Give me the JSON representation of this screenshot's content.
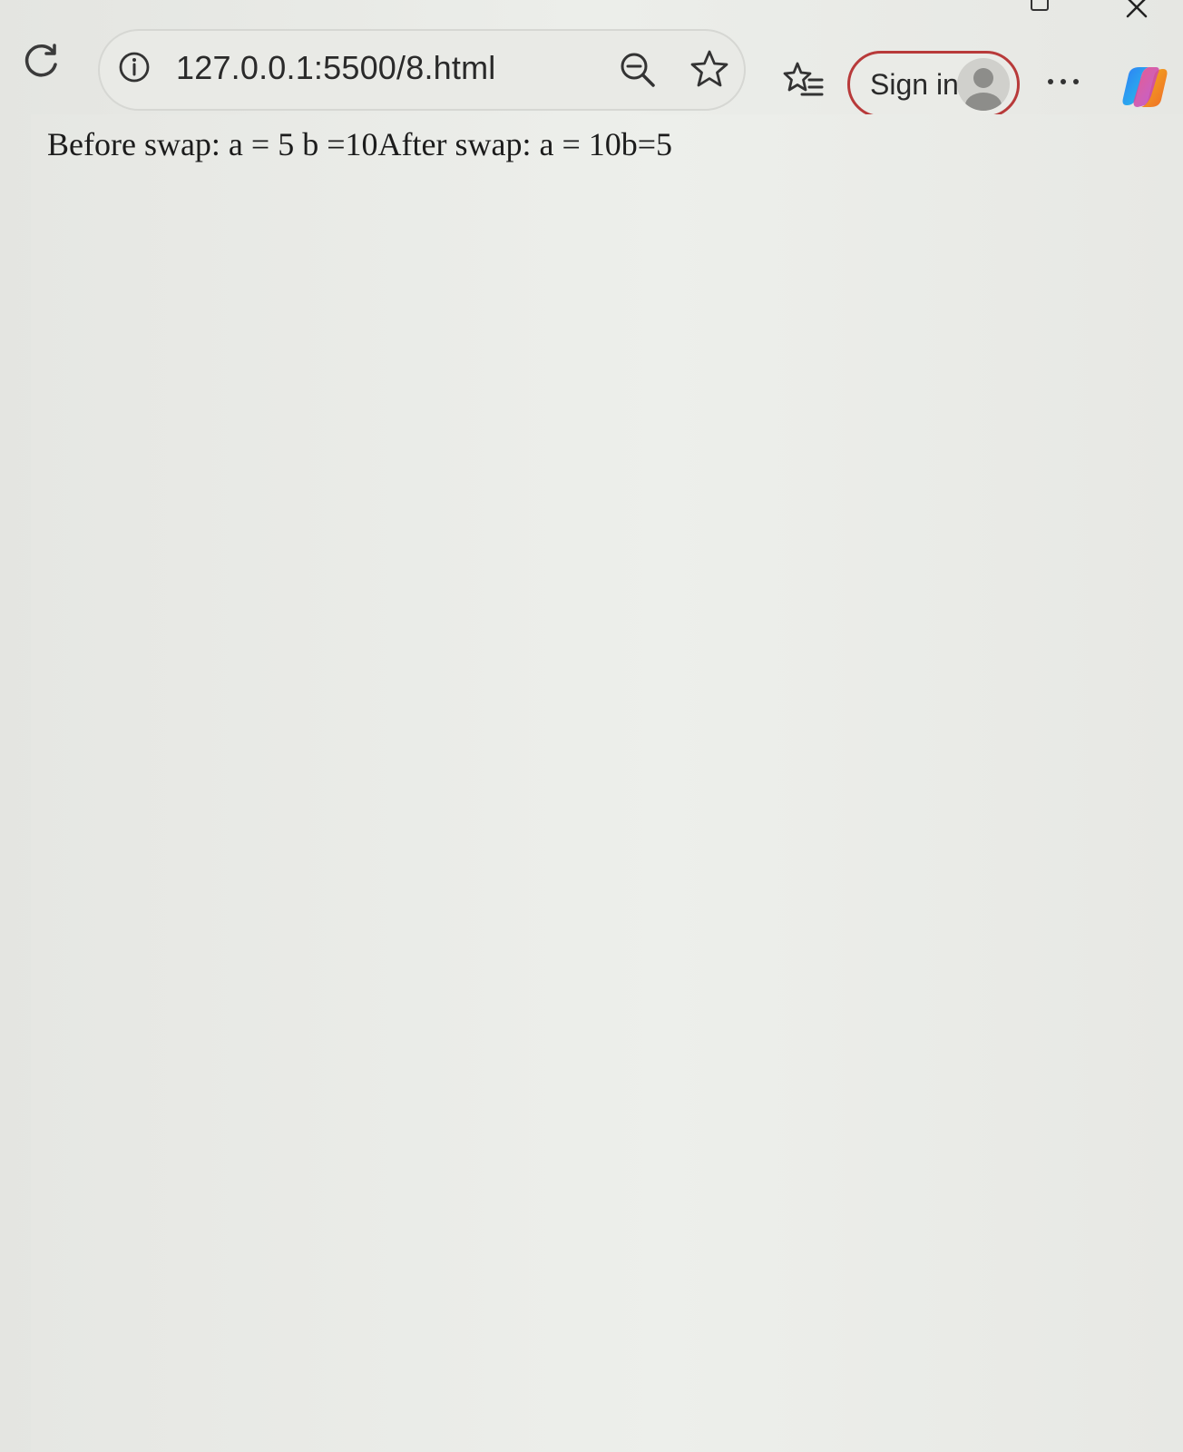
{
  "window": {
    "controls": [
      "restore-icon",
      "close-icon"
    ]
  },
  "toolbar": {
    "url": "127.0.0.1:5500/8.html",
    "signin_label": "Sign in",
    "icons": [
      "refresh-icon",
      "info-icon",
      "zoom-out-icon",
      "star-icon",
      "favorites-icon",
      "avatar",
      "more-icon",
      "copilot-icon"
    ]
  },
  "page": {
    "output": "Before swap: a = 5 b =10After swap: a = 10b=5"
  },
  "colors": {
    "signin_border": "#b83a3a",
    "page_background": "#eceeea"
  }
}
